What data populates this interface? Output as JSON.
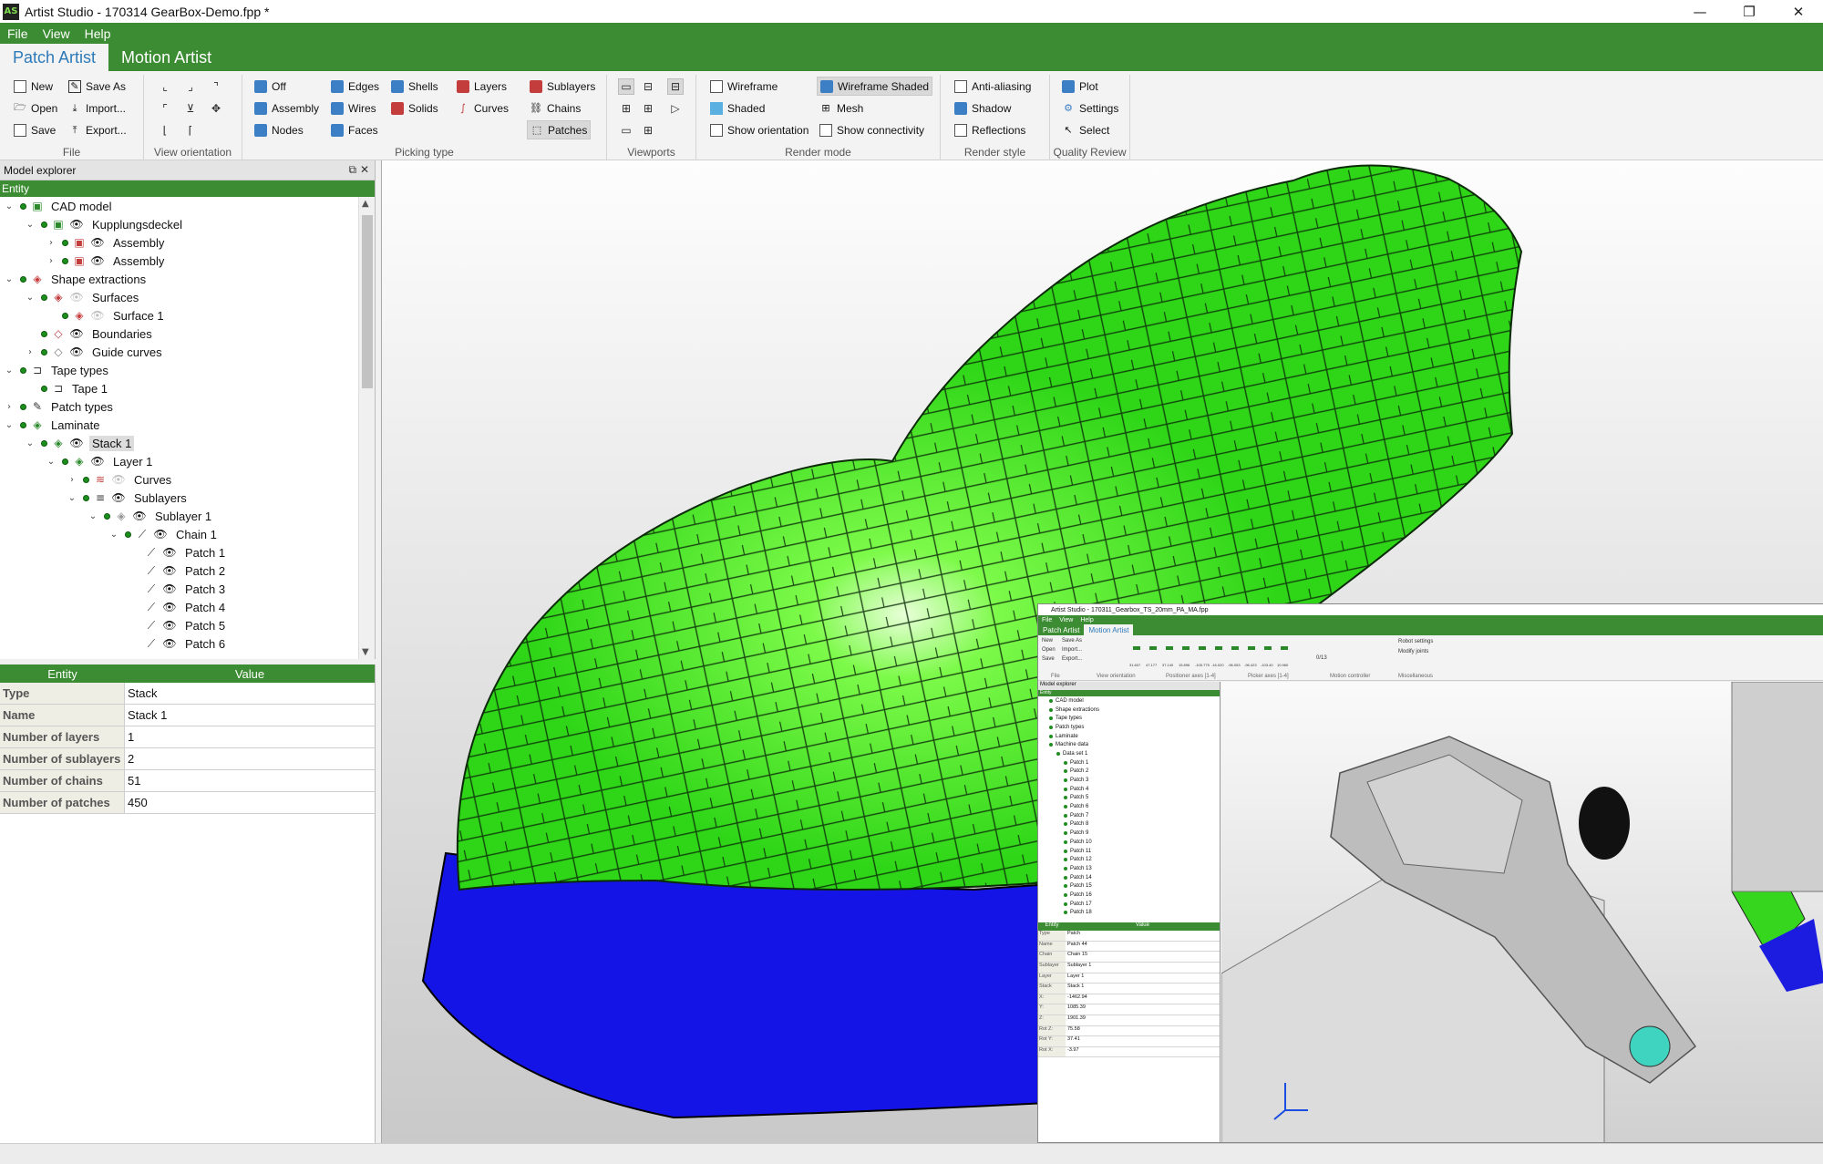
{
  "window": {
    "title": "Artist Studio - 170314 GearBox-Demo.fpp *",
    "app_icon": "AS",
    "minimize": "—",
    "maximize": "❐",
    "close": "✕"
  },
  "menu": [
    "File",
    "View",
    "Help"
  ],
  "ribbon_tabs": [
    "Patch Artist",
    "Motion Artist"
  ],
  "ribbon": {
    "file": {
      "label": "File",
      "new": "New",
      "save_as": "Save As",
      "open": "Open",
      "import": "Import...",
      "save": "Save",
      "export": "Export..."
    },
    "view_orientation": {
      "label": "View orientation"
    },
    "picking_type": {
      "label": "Picking type",
      "off": "Off",
      "edges": "Edges",
      "shells": "Shells",
      "assembly": "Assembly",
      "wires": "Wires",
      "solids": "Solids",
      "nodes": "Nodes",
      "faces": "Faces",
      "layers": "Layers",
      "curves": "Curves",
      "sublayers": "Sublayers",
      "chains": "Chains",
      "patches": "Patches"
    },
    "viewports": {
      "label": "Viewports"
    },
    "render_mode": {
      "label": "Render mode",
      "wireframe": "Wireframe",
      "wireframe_shaded": "Wireframe Shaded",
      "shaded": "Shaded",
      "mesh": "Mesh",
      "show_orientation": "Show orientation",
      "show_connectivity": "Show connectivity"
    },
    "render_style": {
      "label": "Render style",
      "anti_aliasing": "Anti-aliasing",
      "shadow": "Shadow",
      "reflections": "Reflections"
    },
    "quality_review": {
      "label": "Quality Review",
      "plot": "Plot",
      "settings": "Settings",
      "select": "Select"
    }
  },
  "explorer": {
    "title": "Model explorer",
    "header": "Entity",
    "tree": [
      {
        "label": "CAD model",
        "depth": 0,
        "exp": "open",
        "icon": "cad-model-icon",
        "eye": false
      },
      {
        "label": "Kupplungsdeckel",
        "depth": 1,
        "exp": "open",
        "icon": "part-icon",
        "eye": true
      },
      {
        "label": "Assembly",
        "depth": 2,
        "exp": "closed",
        "icon": "assembly-icon",
        "eye": true
      },
      {
        "label": "Assembly",
        "depth": 2,
        "exp": "closed",
        "icon": "assembly-icon",
        "eye": true
      },
      {
        "label": "Shape extractions",
        "depth": 0,
        "exp": "open",
        "icon": "shape-extractions-icon",
        "eye": false
      },
      {
        "label": "Surfaces",
        "depth": 1,
        "exp": "open",
        "icon": "surfaces-icon",
        "eye": "dim"
      },
      {
        "label": "Surface 1",
        "depth": 2,
        "exp": "none",
        "icon": "surface-icon",
        "eye": "dim"
      },
      {
        "label": "Boundaries",
        "depth": 1,
        "exp": "none",
        "icon": "boundaries-icon",
        "eye": true
      },
      {
        "label": "Guide curves",
        "depth": 1,
        "exp": "closed",
        "icon": "guide-curves-icon",
        "eye": true
      },
      {
        "label": "Tape types",
        "depth": 0,
        "exp": "open",
        "icon": "tape-types-icon",
        "eye": false
      },
      {
        "label": "Tape 1",
        "depth": 1,
        "exp": "none",
        "icon": "tape-icon",
        "eye": false
      },
      {
        "label": "Patch types",
        "depth": 0,
        "exp": "closed",
        "icon": "patch-types-icon",
        "eye": false
      },
      {
        "label": "Laminate",
        "depth": 0,
        "exp": "open",
        "icon": "laminate-icon",
        "eye": false
      },
      {
        "label": "Stack 1",
        "depth": 1,
        "exp": "open",
        "icon": "stack-icon",
        "eye": true,
        "selected": true
      },
      {
        "label": "Layer 1",
        "depth": 2,
        "exp": "open",
        "icon": "layer-icon",
        "eye": true
      },
      {
        "label": "Curves",
        "depth": 3,
        "exp": "closed",
        "icon": "curves-icon",
        "eye": "dim"
      },
      {
        "label": "Sublayers",
        "depth": 3,
        "exp": "open",
        "icon": "sublayers-icon",
        "eye": true
      },
      {
        "label": "Sublayer 1",
        "depth": 4,
        "exp": "open",
        "icon": "sublayer-icon",
        "eye": true
      },
      {
        "label": "Chain 1",
        "depth": 5,
        "exp": "open",
        "icon": "chain-icon",
        "eye": true
      },
      {
        "label": "Patch 1",
        "depth": 6,
        "exp": "none",
        "icon": "patch-icon",
        "eye": true
      },
      {
        "label": "Patch 2",
        "depth": 6,
        "exp": "none",
        "icon": "patch-icon",
        "eye": true
      },
      {
        "label": "Patch 3",
        "depth": 6,
        "exp": "none",
        "icon": "patch-icon",
        "eye": true
      },
      {
        "label": "Patch 4",
        "depth": 6,
        "exp": "none",
        "icon": "patch-icon",
        "eye": true
      },
      {
        "label": "Patch 5",
        "depth": 6,
        "exp": "none",
        "icon": "patch-icon",
        "eye": true
      },
      {
        "label": "Patch 6",
        "depth": 6,
        "exp": "none",
        "icon": "patch-icon",
        "eye": true
      }
    ]
  },
  "properties": {
    "header_entity": "Entity",
    "header_value": "Value",
    "rows": [
      {
        "key": "Type",
        "value": "Stack"
      },
      {
        "key": "Name",
        "value": "Stack 1"
      },
      {
        "key": "Number of layers",
        "value": "1"
      },
      {
        "key": "Number of sublayers",
        "value": "2"
      },
      {
        "key": "Number of chains",
        "value": "51"
      },
      {
        "key": "Number of patches",
        "value": "450"
      }
    ]
  },
  "colors": {
    "brand_green": "#3c8c33",
    "patch_green": "#33e61a",
    "base_blue": "#1414e6",
    "accent_blue": "#2e7ab8"
  },
  "inset": {
    "title": "Artist Studio - 170311_Gearbox_TS_20mm_PA_MA.fpp",
    "menu": [
      "File",
      "View",
      "Help"
    ],
    "tabs": [
      "Patch Artist",
      "Motion Artist"
    ],
    "file_buttons": [
      "New",
      "Save As",
      "Open",
      "Import...",
      "Save",
      "Export..."
    ],
    "group_labels": [
      "File",
      "View orientation",
      "Positioner axes [1-4]",
      "Picker axes [1-4]",
      "Motion controller",
      "Miscellaneous"
    ],
    "axis_values": [
      "31.607",
      "47.177",
      "37.140",
      "15.896",
      "-105.775",
      "-16.020",
      "-96.053",
      "-96.423",
      "-103.40",
      "10.960"
    ],
    "motion_value": "0/13",
    "misc_buttons": [
      "Robot settings",
      "Modify joints"
    ],
    "explorer_title": "Model explorer",
    "explorer_header": "Entity",
    "tree": [
      "CAD model",
      "Shape extractions",
      "Tape types",
      "Patch types",
      "Laminate",
      "Machine data",
      "Data set 1",
      "Patch 1",
      "Patch 2",
      "Patch 3",
      "Patch 4",
      "Patch 5",
      "Patch 6",
      "Patch 7",
      "Patch 8",
      "Patch 9",
      "Patch 10",
      "Patch 11",
      "Patch 12",
      "Patch 13",
      "Patch 14",
      "Patch 15",
      "Patch 16",
      "Patch 17",
      "Patch 18"
    ],
    "props_header": [
      "Entity",
      "Value"
    ],
    "props": [
      {
        "key": "Type",
        "value": "Patch"
      },
      {
        "key": "Name",
        "value": "Patch 44"
      },
      {
        "key": "Chain",
        "value": "Chain 15"
      },
      {
        "key": "Sublayer",
        "value": "Sublayer 1"
      },
      {
        "key": "Layer",
        "value": "Layer 1"
      },
      {
        "key": "Stack",
        "value": "Stack 1"
      },
      {
        "key": "X:",
        "value": "-1462.94"
      },
      {
        "key": "Y:",
        "value": "1085.39"
      },
      {
        "key": "Z:",
        "value": "1901.39"
      },
      {
        "key": "Rot Z:",
        "value": "75.58"
      },
      {
        "key": "Rot Y:",
        "value": "37.41"
      },
      {
        "key": "Rot X:",
        "value": "-3.97"
      }
    ]
  }
}
